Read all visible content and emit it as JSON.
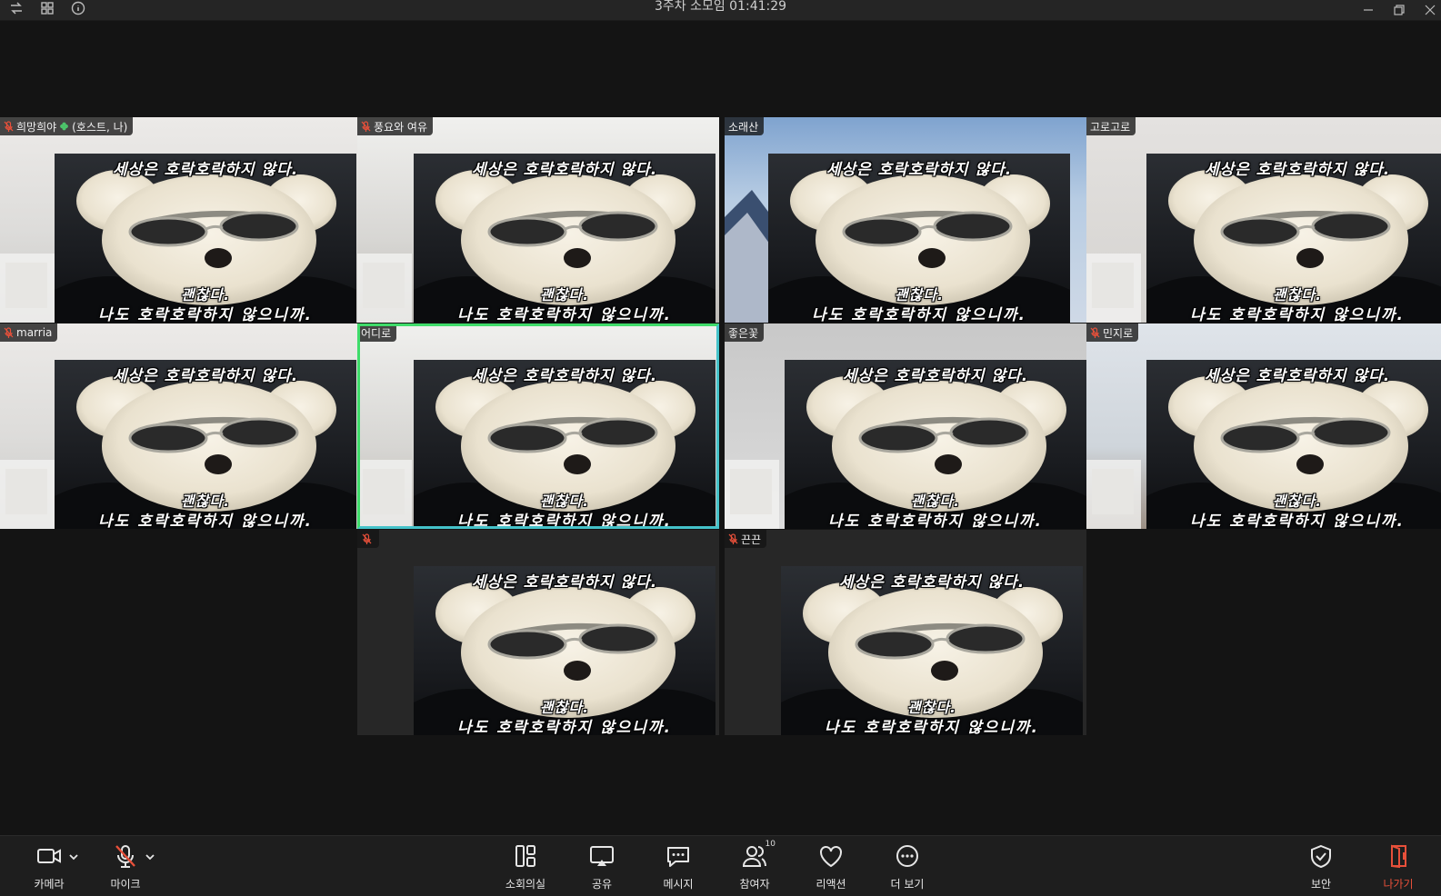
{
  "window": {
    "title": "3주차 소모임 01:41:29"
  },
  "participants": [
    {
      "name": "희망희야",
      "suffix": "(호스트, 나)",
      "muted": true,
      "clover": true
    },
    {
      "name": "풍요와 여유",
      "muted": true
    },
    {
      "name": "소래산",
      "muted": false
    },
    {
      "name": "고로고로",
      "muted": false
    },
    {
      "name": "marria",
      "muted": true
    },
    {
      "name": "어디로",
      "muted": false,
      "speaking": true
    },
    {
      "name": "좋은꽃",
      "muted": false
    },
    {
      "name": "민지로",
      "muted": true
    },
    {
      "name": "",
      "muted": true
    },
    {
      "name": "끈끈",
      "muted": true
    }
  ],
  "video_caption": {
    "line1": "세상은 호락호락하지 않다.",
    "line2": "괜찮다.",
    "line3": "나도 호락호락하지 않으니까."
  },
  "toolbar": {
    "camera": "카메라",
    "mic": "마이크",
    "breakout": "소회의실",
    "share": "공유",
    "chat": "메시지",
    "participants": "참여자",
    "participants_count": "10",
    "reactions": "리액션",
    "more": "더 보기",
    "security": "보안",
    "leave": "나가기"
  },
  "colors": {
    "leave": "#e8503a",
    "mute": "#e8503a",
    "active_speaker": "#3fdc6a"
  }
}
